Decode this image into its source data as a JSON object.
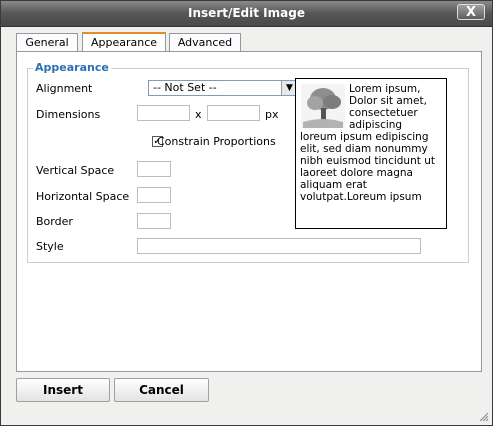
{
  "window": {
    "title": "Insert/Edit Image",
    "close_label": "X"
  },
  "tabs": [
    {
      "label": "General"
    },
    {
      "label": "Appearance",
      "active": true
    },
    {
      "label": "Advanced"
    }
  ],
  "appearance": {
    "legend": "Appearance",
    "alignment_label": "Alignment",
    "alignment_value": "-- Not Set --",
    "dimensions_label": "Dimensions",
    "dimensions_separator": "x",
    "dimensions_unit": "px",
    "width_value": "",
    "height_value": "",
    "constrain_label": "Constrain Proportions",
    "constrain_checked": true,
    "vspace_label": "Vertical Space",
    "vspace_value": "",
    "hspace_label": "Horizontal Space",
    "hspace_value": "",
    "border_label": "Border",
    "border_value": "",
    "style_label": "Style",
    "style_value": "",
    "preview_text": "Lorem ipsum, Dolor sit amet, consectetuer adipiscing loreum ipsum edipiscing elit, sed diam nonummy nibh euismod tincidunt ut laoreet dolore magna aliquam erat volutpat.Loreum ipsum"
  },
  "buttons": {
    "insert": "Insert",
    "cancel": "Cancel"
  }
}
